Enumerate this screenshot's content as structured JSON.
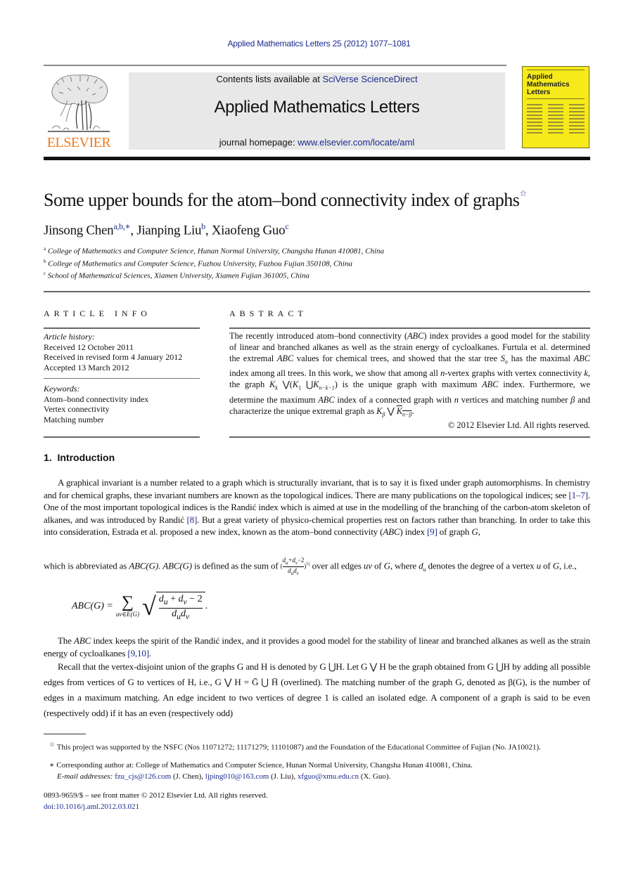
{
  "journal_ref": "Applied Mathematics Letters 25 (2012) 1077–1081",
  "header": {
    "publisher_logo_text": "ELSEVIER",
    "contents_prefix": "Contents lists available at ",
    "contents_link": "SciVerse ScienceDirect",
    "journal_title": "Applied Mathematics Letters",
    "homepage_prefix": "journal homepage: ",
    "homepage_link": "www.elsevier.com/locate/aml",
    "cover": {
      "title_line1": "Applied",
      "title_line2": "Mathematics",
      "title_line3": "Letters",
      "background_color": "#f6ea1a"
    }
  },
  "article": {
    "title": "Some upper bounds for the atom–bond connectivity index of graphs",
    "title_note": "☆",
    "authors": [
      {
        "name": "Jinsong Chen",
        "marks": "a,b,∗",
        "sep": ", "
      },
      {
        "name": "Jianping Liu",
        "marks": "b",
        "sep": ", "
      },
      {
        "name": "Xiaofeng Guo",
        "marks": "c",
        "sep": ""
      }
    ],
    "affiliations": [
      {
        "mark": "a",
        "text": "College of Mathematics and Computer Science, Hunan Normal University, Changsha Hunan 410081, China"
      },
      {
        "mark": "b",
        "text": "College of Mathematics and Computer Science, Fuzhou University, Fuzhou Fujian 350108, China"
      },
      {
        "mark": "c",
        "text": "School of Mathematical Sciences, Xiamen University, Xiamen Fujian 361005, China"
      }
    ]
  },
  "article_info": {
    "heading": "ARTICLE INFO",
    "history_label": "Article history:",
    "history": [
      "Received 12 October 2011",
      "Received in revised form 4 January 2012",
      "Accepted 13 March 2012"
    ],
    "keywords_label": "Keywords:",
    "keywords": [
      "Atom–bond connectivity index",
      "Vertex connectivity",
      "Matching number"
    ]
  },
  "abstract": {
    "heading": "ABSTRACT",
    "text_parts": [
      "The recently introduced atom–bond connectivity (",
      "ABC",
      ") index provides a good model for the stability of linear and branched alkanes as well as the strain energy of cycloalkanes. Furtula et al. determined the extremal ",
      "ABC",
      " values for chemical trees, and showed that the star tree ",
      "S",
      "n",
      " has the maximal ",
      "ABC",
      " index among all trees. In this work, we show that among all ",
      "n",
      "-vertex graphs with vertex connectivity ",
      "k",
      ", the graph ",
      "K_k ⋁(K_1 ⋃K_{n−k−1})",
      " is the unique graph with maximum ",
      "ABC",
      " index. Furthermore, we determine the maximum ",
      "ABC",
      " index of a connected graph with ",
      "n",
      " vertices and matching number ",
      "β",
      " and characterize the unique extremal graph as ",
      "K_β ⋁ K̄_{n−β}",
      "."
    ],
    "copyright": "© 2012 Elsevier Ltd. All rights reserved."
  },
  "section": {
    "number": "1.",
    "title": "Introduction"
  },
  "body": {
    "p1": "A graphical invariant is a number related to a graph which is structurally invariant, that is to say it is fixed under graph automorphisms. In chemistry and for chemical graphs, these invariant numbers are known as the topological indices. There are many publications on the topological indices; see ",
    "p1_ref1": "[1–7]",
    "p1_b": ". One of the most important topological indices is the Randić index which is aimed at use in the modelling of the branching of the carbon-atom skeleton of alkanes, and was introduced by Randić ",
    "p1_ref2": "[8]",
    "p1_c": ". But a great variety of physico-chemical properties rest on factors rather than branching. In order to take this into consideration, Estrada et al. proposed a new index, known as the atom–bond connectivity (",
    "p1_abc": "ABC",
    "p1_d": ") index ",
    "p1_ref3": "[9]",
    "p1_e": " of graph ",
    "p1_G": "G",
    "p1_f": ",",
    "p2_a": "which is abbreviated as ",
    "p2_abcg": "ABC(G)",
    "p2_b": ". ",
    "p2_c": " is defined as the sum of ",
    "p2_d": " over all edges ",
    "p2_uv": "uv",
    "p2_e": " of ",
    "p2_f": ", where ",
    "p2_du": "d",
    "p2_g": " denotes the degree of a vertex ",
    "p2_u": "u",
    "p2_h": " of ",
    "p2_i": ", i.e.,",
    "formula_lhs": "ABC(G) =",
    "formula_sum_sub": "uv∈E(G)",
    "formula_num": "d",
    "formula_den": "d",
    "p3_a": "The ",
    "p3_abc": "ABC",
    "p3_b": " index keeps the spirit of the Randić index, and it provides a good model for the stability of linear and branched alkanes as well as the strain energy of cycloalkanes ",
    "p3_ref": "[9,10]",
    "p3_c": ".",
    "p4": "Recall that the vertex-disjoint union of the graphs G and H is denoted by G ⋃H. Let G ⋁ H be the graph obtained from G ⋃H by adding all possible edges from vertices of G to vertices of H, i.e., G ⋁ H = Ḡ ⋃ H̄ (overlined). The matching number of the graph G, denoted as β(G), is the number of edges in a maximum matching. An edge incident to two vertices of degree 1 is called an isolated edge. A component of a graph is said to be even (respectively odd) if it has an even (respectively odd)"
  },
  "footnotes": {
    "star_mark": "☆",
    "star_text": "This project was supported by the NSFC (Nos 11071272; 11171279; 11101087) and the Foundation of the Educational Committee of Fujian (No. JA10021).",
    "corr_mark": "∗",
    "corr_text": "Corresponding author at: College of Mathematics and Computer Science, Hunan Normal University, Changsha Hunan 410081, China.",
    "email_label": "E-mail addresses: ",
    "emails": [
      {
        "address": "fzu_cjs@126.com",
        "who": " (J. Chen), "
      },
      {
        "address": "ljping010@163.com",
        "who": " (J. Liu), "
      },
      {
        "address": "xfguo@xmu.edu.cn",
        "who": " (X. Guo)."
      }
    ],
    "issn_line": "0893-9659/$ – see front matter © 2012 Elsevier Ltd. All rights reserved.",
    "doi": "doi:10.1016/j.aml.2012.03.021"
  }
}
